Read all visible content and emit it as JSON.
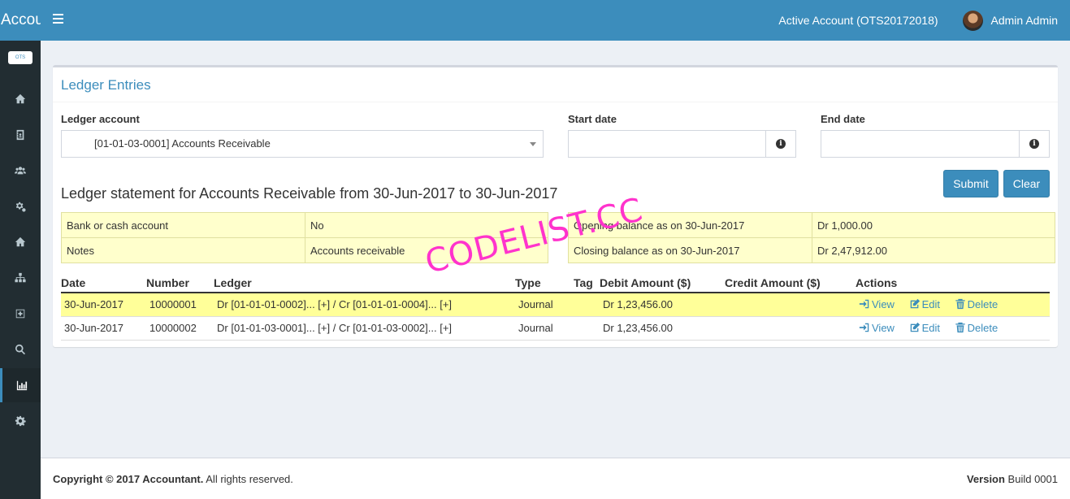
{
  "header": {
    "brand": "Accountant",
    "active_account": "Active Account (OTS20172018)",
    "user_name": "Admin Admin"
  },
  "sidebar": {
    "logo_text": "OTS",
    "items": [
      {
        "icon": "home-icon"
      },
      {
        "icon": "address-book-icon"
      },
      {
        "icon": "users-icon"
      },
      {
        "icon": "cogs-icon"
      },
      {
        "icon": "home-icon"
      },
      {
        "icon": "sitemap-icon"
      },
      {
        "icon": "plus-square-icon"
      },
      {
        "icon": "search-icon"
      },
      {
        "icon": "bar-chart-icon",
        "active": true
      },
      {
        "icon": "gear-icon"
      }
    ]
  },
  "form": {
    "box_title": "Ledger Entries",
    "ledger_label": "Ledger account",
    "ledger_value": "[01-01-03-0001] Accounts Receivable",
    "start_label": "Start date",
    "start_value": "",
    "end_label": "End date",
    "end_value": "",
    "submit_label": "Submit",
    "clear_label": "Clear"
  },
  "statement": {
    "title": "Ledger statement for Accounts Receivable from 30-Jun-2017 to 30-Jun-2017",
    "left": [
      {
        "label": "Bank or cash account",
        "value": "No"
      },
      {
        "label": "Notes",
        "value": "Accounts receivable"
      }
    ],
    "right": [
      {
        "label": "Opening balance as on 30-Jun-2017",
        "value": "Dr 1,000.00"
      },
      {
        "label": "Closing balance as on 30-Jun-2017",
        "value": "Dr 2,47,912.00"
      }
    ]
  },
  "table": {
    "columns": [
      "Date",
      "Number",
      "Ledger",
      "Type",
      "Tag",
      "Debit Amount ($)",
      "Credit Amount ($)",
      "Actions"
    ],
    "rows": [
      {
        "date": "30-Jun-2017",
        "number": "10000001",
        "ledger": "Dr [01-01-01-0002]... [+] / Cr [01-01-01-0004]... [+]",
        "type": "Journal",
        "tag": "",
        "debit": "Dr 1,23,456.00",
        "credit": "",
        "highlight": true
      },
      {
        "date": "30-Jun-2017",
        "number": "10000002",
        "ledger": "Dr [01-01-03-0001]... [+] / Cr [01-01-03-0002]... [+]",
        "type": "Journal",
        "tag": "",
        "debit": "Dr 1,23,456.00",
        "credit": "",
        "highlight": false
      }
    ],
    "actions": {
      "view": "View",
      "edit": "Edit",
      "delete": "Delete"
    }
  },
  "watermark": "CODELIST.CC",
  "footer": {
    "copyright_bold": "Copyright © 2017 Accountant.",
    "copyright_rest": " All rights reserved.",
    "version_bold": "Version",
    "version_rest": " Build 0001"
  },
  "colors": {
    "primary": "#3c8dbc",
    "sidebar": "#222d32",
    "highlight": "#ffff99",
    "summary": "#ffffcc",
    "watermark": "#ff33cc"
  }
}
